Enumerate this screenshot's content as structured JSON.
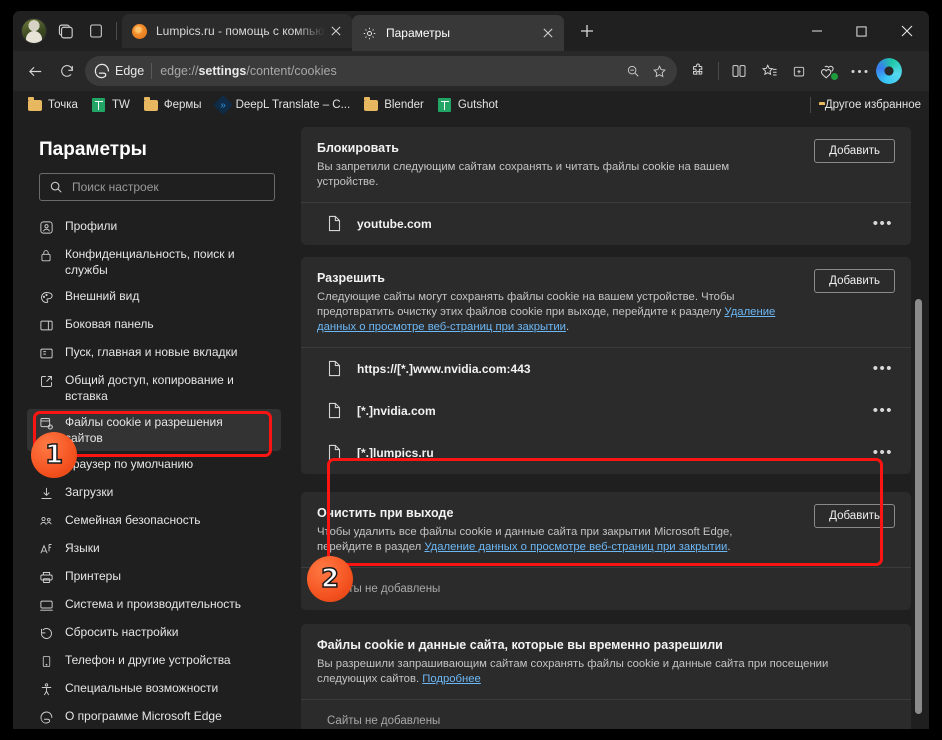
{
  "window": {
    "minimize_label": "Свернуть",
    "maximize_label": "Развернуть",
    "close_label": "Закрыть",
    "newtab_label": "+"
  },
  "tabs": [
    {
      "title": "Lumpics.ru - помощь с компьютером",
      "favicon": "orange-circle-icon",
      "active": false
    },
    {
      "title": "Параметры",
      "favicon": "gear-icon",
      "active": true
    }
  ],
  "address_bar": {
    "brand": "Edge",
    "url_prefix": "edge://",
    "url_bold": "settings",
    "url_suffix": "/content/cookies",
    "url_full": "edge://settings/content/cookies"
  },
  "bookmarks": [
    {
      "label": "Точка",
      "icon": "folder-icon"
    },
    {
      "label": "TW",
      "icon": "google-sheets-icon"
    },
    {
      "label": "Фермы",
      "icon": "folder-icon"
    },
    {
      "label": "DeepL Translate – C...",
      "icon": "deepl-icon"
    },
    {
      "label": "Blender",
      "icon": "folder-icon"
    },
    {
      "label": "Gutshot",
      "icon": "google-sheets-icon"
    }
  ],
  "bookmarks_other": {
    "label": "Другое избранное",
    "icon": "folder-icon"
  },
  "sidebar": {
    "title": "Параметры",
    "search_placeholder": "Поиск настроек",
    "items": [
      {
        "label": "Профили",
        "icon": "profile-icon",
        "selected": false
      },
      {
        "label": "Конфиденциальность, поиск и службы",
        "icon": "lock-icon",
        "selected": false
      },
      {
        "label": "Внешний вид",
        "icon": "appearance-icon",
        "selected": false
      },
      {
        "label": "Боковая панель",
        "icon": "sidebar-icon",
        "selected": false
      },
      {
        "label": "Пуск, главная и новые вкладки",
        "icon": "start-home-icon",
        "selected": false
      },
      {
        "label": "Общий доступ, копирование и вставка",
        "icon": "share-icon",
        "selected": false
      },
      {
        "label": "Файлы cookie и разрешения сайтов",
        "icon": "cookie-permissions-icon",
        "selected": true
      },
      {
        "label": "Браузер по умолчанию",
        "icon": "default-browser-icon",
        "selected": false
      },
      {
        "label": "Загрузки",
        "icon": "download-icon",
        "selected": false
      },
      {
        "label": "Семейная безопасность",
        "icon": "family-safety-icon",
        "selected": false
      },
      {
        "label": "Языки",
        "icon": "languages-icon",
        "selected": false
      },
      {
        "label": "Принтеры",
        "icon": "printer-icon",
        "selected": false
      },
      {
        "label": "Система и производительность",
        "icon": "system-icon",
        "selected": false
      },
      {
        "label": "Сбросить настройки",
        "icon": "reset-icon",
        "selected": false
      },
      {
        "label": "Телефон и другие устройства",
        "icon": "phone-icon",
        "selected": false
      },
      {
        "label": "Специальные возможности",
        "icon": "accessibility-icon",
        "selected": false
      },
      {
        "label": "О программе Microsoft Edge",
        "icon": "edge-icon",
        "selected": false
      }
    ]
  },
  "main": {
    "add_button_label": "Добавить",
    "empty_label": "Сайты не добавлены",
    "sections": [
      {
        "title": "Блокировать",
        "desc": "Вы запретили следующим сайтам сохранять и читать файлы cookie на вашем устройстве.",
        "link": "",
        "link_tail": "",
        "has_add": true,
        "sites": [
          "youtube.com"
        ],
        "empty": false
      },
      {
        "title": "Разрешить",
        "desc": "Следующие сайты могут сохранять файлы cookie на вашем устройстве. Чтобы предотвратить очистку этих файлов cookie при выходе, перейдите к разделу ",
        "link": "Удаление данных о просмотре веб-страниц при закрытии",
        "link_tail": ".",
        "has_add": true,
        "sites": [
          "https://[*.]www.nvidia.com:443",
          "[*.]nvidia.com",
          "[*.]lumpics.ru"
        ],
        "empty": false
      },
      {
        "title": "Очистить при выходе",
        "desc": "Чтобы удалить все файлы cookie и данные сайта при закрытии Microsoft Edge, перейдите в раздел ",
        "link": "Удаление данных о просмотре веб-страниц при закрытии",
        "link_tail": ".",
        "has_add": true,
        "sites": [],
        "empty": true
      },
      {
        "title": "Файлы cookie и данные сайта, которые вы временно разрешили",
        "desc": "Вы разрешили запрашивающим сайтам сохранять файлы cookie и данные сайта при посещении следующих сайтов. ",
        "link": "Подробнее",
        "link_tail": "",
        "has_add": false,
        "sites": [],
        "empty": true
      }
    ]
  },
  "annotations": {
    "badge_one": "1",
    "badge_two": "2",
    "highlight_color": "#fb1512"
  }
}
